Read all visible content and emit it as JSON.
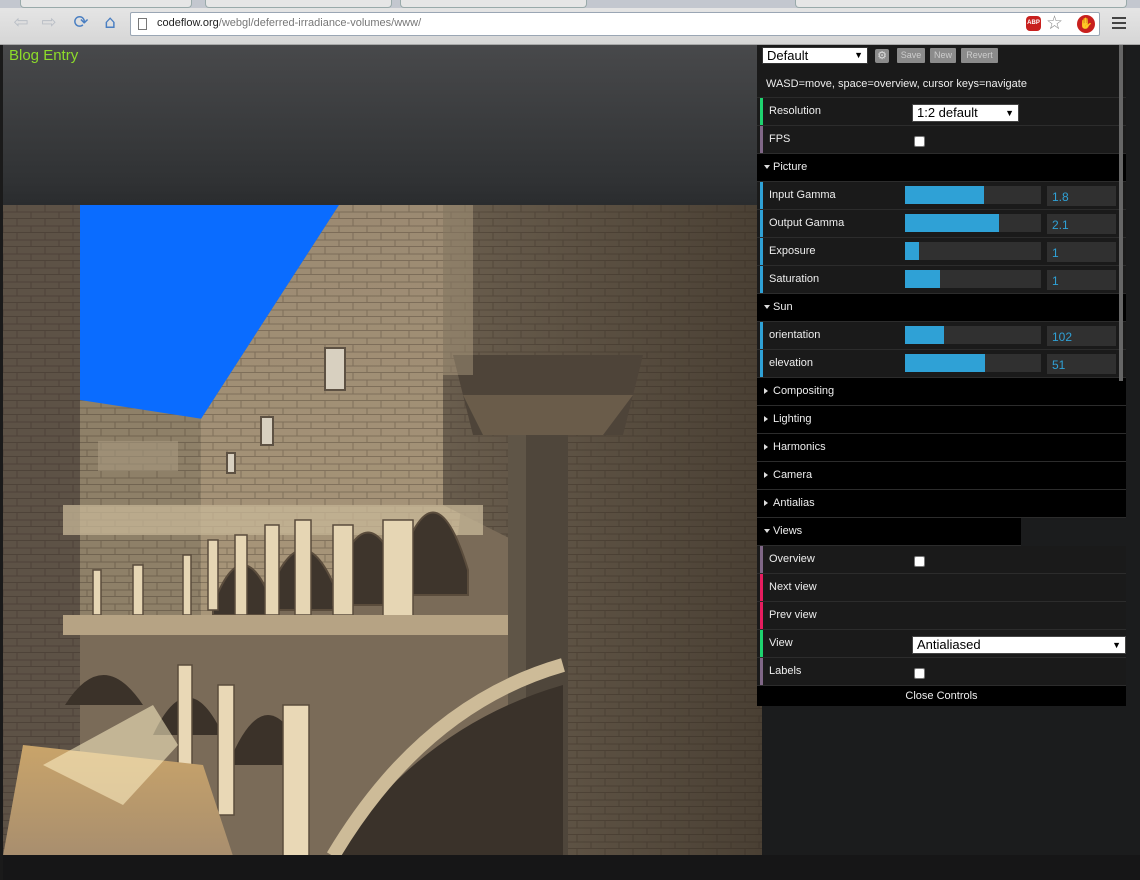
{
  "browser": {
    "url_host": "codeflow.org",
    "url_path": "/webgl/deferred-irradiance-volumes/www/",
    "abp_label": "ABP"
  },
  "page": {
    "blog_link": "Blog Entry"
  },
  "panel": {
    "preset": "Default",
    "buttons": {
      "save": "Save",
      "new": "New",
      "revert": "Revert"
    },
    "help": "WASD=move, space=overview, cursor keys=navigate",
    "resolution": {
      "label": "Resolution",
      "value": "1:2 default"
    },
    "fps": {
      "label": "FPS",
      "checked": false
    },
    "picture": {
      "label": "Picture",
      "input_gamma": {
        "label": "Input Gamma",
        "value": "1.8",
        "fill": 0.58
      },
      "output_gamma": {
        "label": "Output Gamma",
        "value": "2.1",
        "fill": 0.69
      },
      "exposure": {
        "label": "Exposure",
        "value": "1",
        "fill": 0.1
      },
      "saturation": {
        "label": "Saturation",
        "value": "1",
        "fill": 0.26
      }
    },
    "sun": {
      "label": "Sun",
      "orientation": {
        "label": "orientation",
        "value": "102",
        "fill": 0.29
      },
      "elevation": {
        "label": "elevation",
        "value": "51",
        "fill": 0.59
      }
    },
    "folders": {
      "compositing": "Compositing",
      "lighting": "Lighting",
      "harmonics": "Harmonics",
      "camera": "Camera",
      "antialias": "Antialias"
    },
    "views": {
      "label": "Views",
      "overview": "Overview",
      "next_view": "Next view",
      "prev_view": "Prev view",
      "view": {
        "label": "View",
        "value": "Antialiased"
      },
      "labels": "Labels"
    },
    "close": "Close Controls"
  },
  "colors": {
    "accent_slider": "#2fa1d6",
    "link_green": "#8ddc2a",
    "bar_number": "#2fa1d6",
    "bar_boolean": "#806787",
    "bar_function": "#e61d5f",
    "bar_option": "#1ed36f"
  }
}
